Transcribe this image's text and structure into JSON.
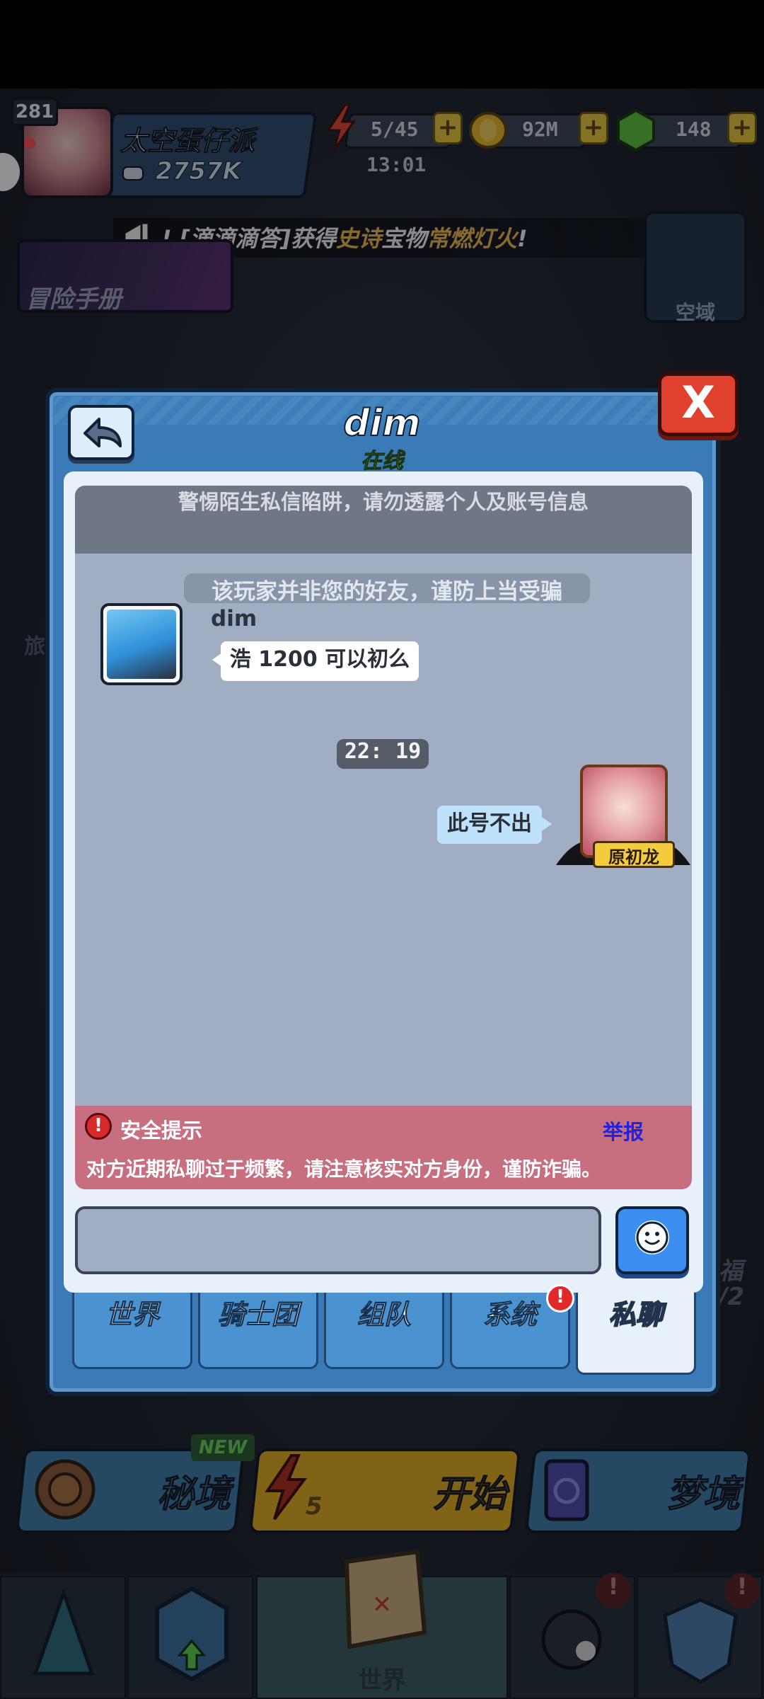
{
  "hud": {
    "level": "281",
    "player_name": "太空蛋仔派",
    "power": "2757K",
    "stamina": "5/45",
    "stamina_timer": "13:01",
    "gold": "92M",
    "gems": "148",
    "plus": "+"
  },
  "announcement": {
    "prefix": "! [滴滴滴答]获得",
    "rarity": "史诗",
    "middle": "宝物",
    "item": "常燃灯火",
    "suffix": "!"
  },
  "side_buttons": {
    "adventure": "冒险手册",
    "space": "空域",
    "left_peek": "旅",
    "right_peek_1": "福",
    "right_peek_2": "/2"
  },
  "chat": {
    "title": "dim",
    "status": "在线",
    "close_label": "X",
    "warning": "警惕陌生私信陷阱，请勿透露个人及账号信息",
    "not_friend_notice": "该玩家并非您的好友，谨防上当受骗",
    "messages": [
      {
        "sender": "dim",
        "text": "浩 1200 可以初么",
        "side": "left"
      },
      {
        "sender": "原初龙",
        "text": "此号不出",
        "side": "right"
      }
    ],
    "timestamp": "22: 19",
    "self_tag": "原初龙",
    "safety_title": "安全提示",
    "safety_text": "对方近期私聊过于频繁，请注意核实对方身份，谨防诈骗。",
    "report": "举报",
    "input_placeholder": ""
  },
  "tabs": [
    {
      "label": "世界",
      "active": false
    },
    {
      "label": "骑士团",
      "active": false
    },
    {
      "label": "组队",
      "active": false
    },
    {
      "label": "系统",
      "active": false,
      "alert": true
    },
    {
      "label": "私聊",
      "active": true
    }
  ],
  "alert_mark": "!",
  "modes": {
    "secret": "秘境",
    "new_badge": "NEW",
    "start": "开始",
    "start_cost": "5",
    "dream": "梦境"
  },
  "bottom_nav": {
    "world": "世界"
  },
  "colors": {
    "dialog_blue": "#3a7ab6",
    "message_area": "#a1adc2",
    "safety_red": "#c76e80",
    "report_blue": "#2222d8",
    "online_green": "#9ce24a",
    "close_red": "#e0402e"
  }
}
